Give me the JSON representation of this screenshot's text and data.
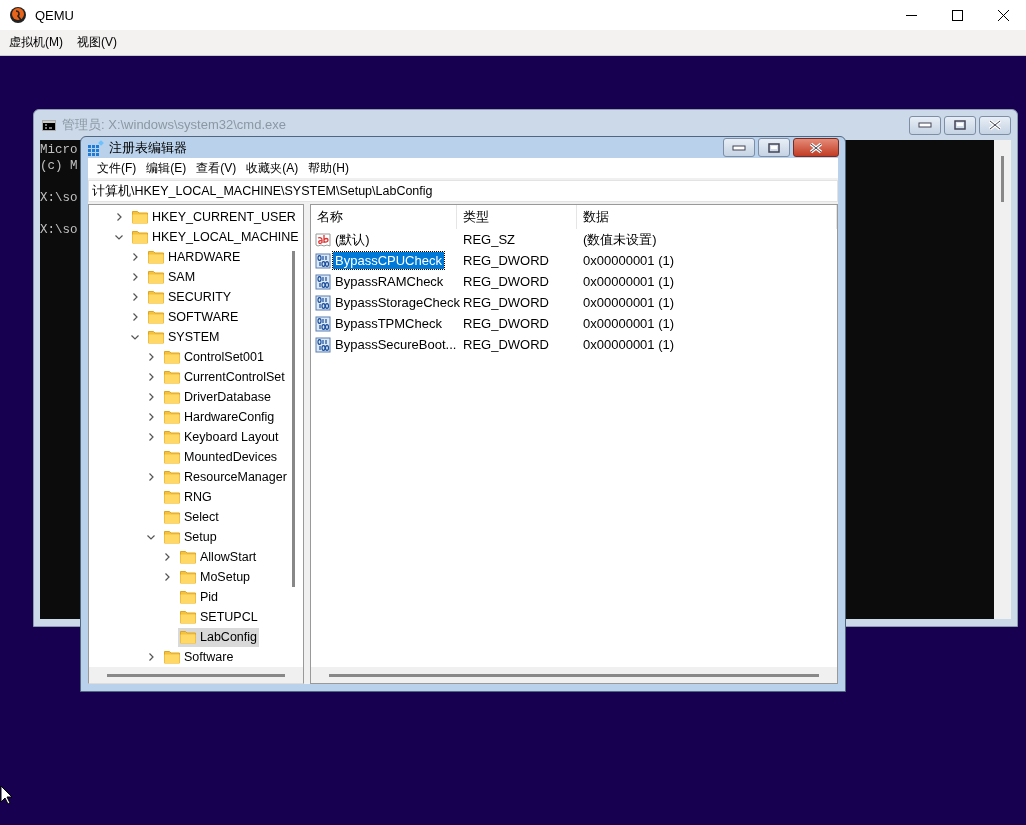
{
  "window": {
    "title": "QEMU"
  },
  "menu": [
    "虚拟机(M)",
    "视图(V)"
  ],
  "cmd": {
    "title": "管理员: X:\\windows\\system32\\cmd.exe",
    "lines": [
      {
        "text": "Micro",
        "blank_before": false
      },
      {
        "text": "(c) M",
        "blank_before": false
      },
      {
        "text": "X:\\so",
        "blank_before": true
      },
      {
        "text": "X:\\so",
        "blank_before": true
      }
    ]
  },
  "regedit": {
    "title": "注册表编辑器",
    "menu": [
      "文件(F)",
      "编辑(E)",
      "查看(V)",
      "收藏夹(A)",
      "帮助(H)"
    ],
    "address": "计算机\\HKEY_LOCAL_MACHINE\\SYSTEM\\Setup\\LabConfig",
    "tree": [
      {
        "label": "HKEY_CURRENT_USER",
        "kind": "branch",
        "expanded": false,
        "selected": false
      },
      {
        "label": "HKEY_LOCAL_MACHINE",
        "kind": "branch",
        "expanded": true,
        "selected": false,
        "children": [
          {
            "label": "HARDWARE",
            "kind": "branch",
            "expanded": false,
            "selected": false
          },
          {
            "label": "SAM",
            "kind": "branch",
            "expanded": false,
            "selected": false
          },
          {
            "label": "SECURITY",
            "kind": "branch",
            "expanded": false,
            "selected": false
          },
          {
            "label": "SOFTWARE",
            "kind": "branch",
            "expanded": false,
            "selected": false
          },
          {
            "label": "SYSTEM",
            "kind": "branch",
            "expanded": true,
            "selected": false,
            "children": [
              {
                "label": "ControlSet001",
                "kind": "branch",
                "expanded": false,
                "selected": false
              },
              {
                "label": "CurrentControlSet",
                "kind": "branch",
                "expanded": false,
                "selected": false
              },
              {
                "label": "DriverDatabase",
                "kind": "branch",
                "expanded": false,
                "selected": false
              },
              {
                "label": "HardwareConfig",
                "kind": "branch",
                "expanded": false,
                "selected": false
              },
              {
                "label": "Keyboard Layout",
                "kind": "branch",
                "expanded": false,
                "selected": false
              },
              {
                "label": "MountedDevices",
                "kind": "leaf",
                "selected": false
              },
              {
                "label": "ResourceManager",
                "kind": "branch",
                "expanded": false,
                "selected": false
              },
              {
                "label": "RNG",
                "kind": "leaf",
                "selected": false
              },
              {
                "label": "Select",
                "kind": "leaf",
                "selected": false
              },
              {
                "label": "Setup",
                "kind": "branch",
                "expanded": true,
                "selected": false,
                "children": [
                  {
                    "label": "AllowStart",
                    "kind": "branch",
                    "expanded": false,
                    "selected": false
                  },
                  {
                    "label": "MoSetup",
                    "kind": "branch",
                    "expanded": false,
                    "selected": false
                  },
                  {
                    "label": "Pid",
                    "kind": "leaf",
                    "selected": false
                  },
                  {
                    "label": "SETUPCL",
                    "kind": "leaf",
                    "selected": false
                  },
                  {
                    "label": "LabConfig",
                    "kind": "leaf",
                    "selected": true
                  }
                ]
              },
              {
                "label": "Software",
                "kind": "branch",
                "expanded": false,
                "selected": false
              }
            ]
          }
        ]
      }
    ],
    "columns": [
      "名称",
      "类型",
      "数据"
    ],
    "rows": [
      {
        "kind": "string",
        "name": "(默认)",
        "type": "REG_SZ",
        "data": "(数值未设置)",
        "selected": false
      },
      {
        "kind": "dword",
        "name": "BypassCPUCheck",
        "type": "REG_DWORD",
        "data": "0x00000001 (1)",
        "selected": true
      },
      {
        "kind": "dword",
        "name": "BypassRAMCheck",
        "type": "REG_DWORD",
        "data": "0x00000001 (1)",
        "selected": false
      },
      {
        "kind": "dword",
        "name": "BypassStorageCheck",
        "type": "REG_DWORD",
        "data": "0x00000001 (1)",
        "selected": false
      },
      {
        "kind": "dword",
        "name": "BypassTPMCheck",
        "type": "REG_DWORD",
        "data": "0x00000001 (1)",
        "selected": false
      },
      {
        "kind": "dword",
        "name": "BypassSecureBoot...",
        "type": "REG_DWORD",
        "data": "0x00000001 (1)",
        "selected": false
      }
    ]
  }
}
